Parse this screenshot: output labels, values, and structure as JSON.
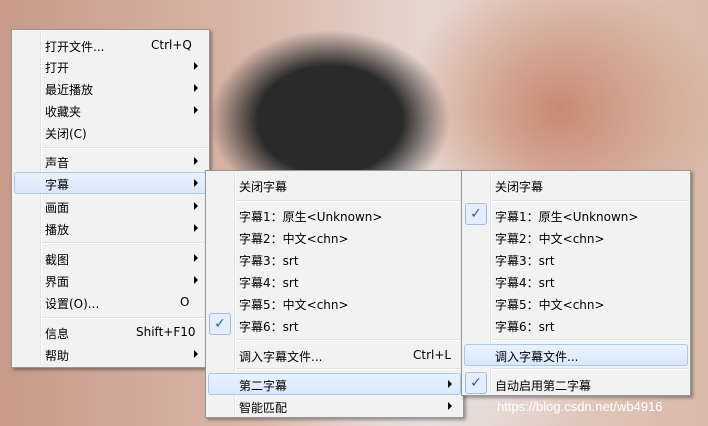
{
  "main_menu": {
    "items": [
      {
        "label": "打开文件...",
        "shortcut": "Ctrl+Q"
      },
      {
        "label": "打开"
      },
      {
        "label": "最近播放"
      },
      {
        "label": "收藏夹"
      },
      {
        "label": "关闭(C)"
      },
      {
        "label": "声音"
      },
      {
        "label": "字幕"
      },
      {
        "label": "画面"
      },
      {
        "label": "播放"
      },
      {
        "label": "截图"
      },
      {
        "label": "界面"
      },
      {
        "label": "设置(O)...",
        "shortcut": "O"
      },
      {
        "label": "信息",
        "shortcut": "Shift+F10"
      },
      {
        "label": "帮助"
      }
    ]
  },
  "subtitle_menu": {
    "items": [
      {
        "label": "关闭字幕"
      },
      {
        "label": "字幕1：原生<Unknown>"
      },
      {
        "label": "字幕2：中文<chn>"
      },
      {
        "label": "字幕3：srt"
      },
      {
        "label": "字幕4：srt"
      },
      {
        "label": "字幕5：中文<chn>"
      },
      {
        "label": "字幕6：srt",
        "checked": true
      },
      {
        "label": "调入字幕文件...",
        "shortcut": "Ctrl+L"
      },
      {
        "label": "第二字幕"
      },
      {
        "label": "智能匹配"
      }
    ]
  },
  "second_subtitle_menu": {
    "items": [
      {
        "label": "关闭字幕"
      },
      {
        "label": "字幕1：原生<Unknown>",
        "checked": true
      },
      {
        "label": "字幕2：中文<chn>"
      },
      {
        "label": "字幕3：srt"
      },
      {
        "label": "字幕4：srt"
      },
      {
        "label": "字幕5：中文<chn>"
      },
      {
        "label": "字幕6：srt"
      },
      {
        "label": "调入字幕文件..."
      },
      {
        "label": "自动启用第二字幕",
        "checked": true
      }
    ]
  },
  "check_glyph": "✓",
  "watermark": "https://blog.csdn.net/wb4916",
  "colors": {
    "highlight": "#dae8fc",
    "check": "#1f5fbf",
    "menu_bg": "#f2f2f2"
  }
}
